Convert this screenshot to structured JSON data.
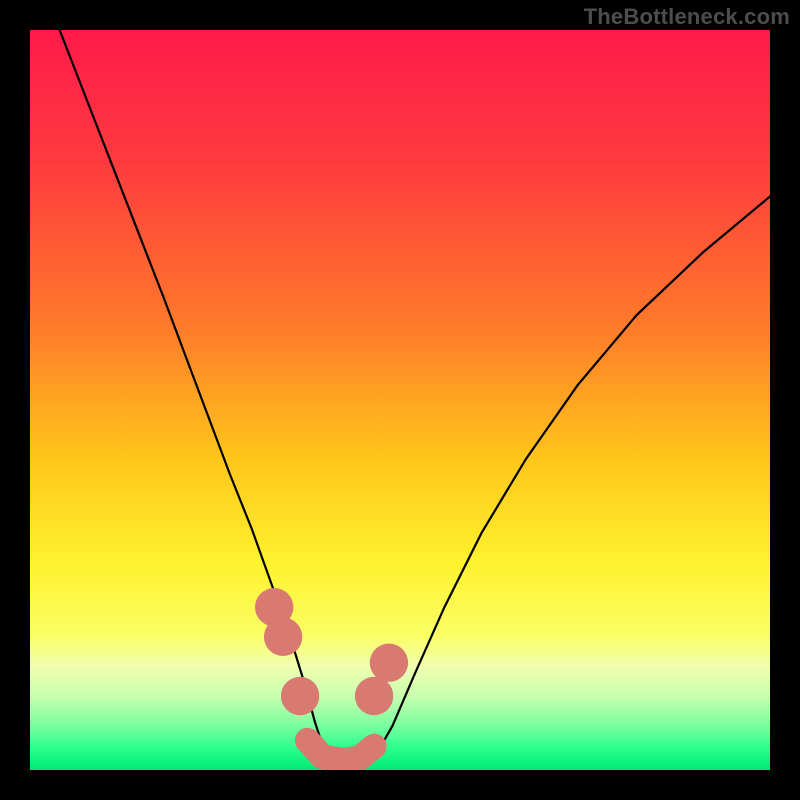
{
  "watermark": "TheBottleneck.com",
  "chart_data": {
    "type": "line",
    "title": "",
    "xlabel": "",
    "ylabel": "",
    "xlim": [
      0,
      100
    ],
    "ylim": [
      0,
      100
    ],
    "gradient_stops": [
      {
        "offset": 0.0,
        "color": "#ff1a4a"
      },
      {
        "offset": 0.18,
        "color": "#ff3b3f"
      },
      {
        "offset": 0.4,
        "color": "#ff7a2a"
      },
      {
        "offset": 0.58,
        "color": "#ffc61a"
      },
      {
        "offset": 0.72,
        "color": "#fff22e"
      },
      {
        "offset": 0.82,
        "color": "#faff66"
      },
      {
        "offset": 0.86,
        "color": "#f0ffb0"
      },
      {
        "offset": 0.9,
        "color": "#c9ffb0"
      },
      {
        "offset": 0.94,
        "color": "#7aff9e"
      },
      {
        "offset": 0.97,
        "color": "#2bff8c"
      },
      {
        "offset": 1.0,
        "color": "#00e878"
      }
    ],
    "series": [
      {
        "name": "left-branch",
        "x": [
          4.0,
          7.5,
          11.0,
          14.5,
          18.0,
          21.0,
          24.0,
          27.0,
          30.0,
          32.5,
          35.0,
          37.0,
          38.5,
          39.8
        ],
        "y": [
          100.0,
          91.0,
          82.0,
          73.0,
          64.0,
          56.0,
          48.0,
          40.0,
          32.5,
          25.5,
          18.5,
          12.0,
          6.5,
          2.5
        ]
      },
      {
        "name": "right-branch",
        "x": [
          47.0,
          49.0,
          52.0,
          56.0,
          61.0,
          67.0,
          74.0,
          82.0,
          91.0,
          100.0
        ],
        "y": [
          2.5,
          6.0,
          13.0,
          22.0,
          32.0,
          42.0,
          52.0,
          61.5,
          70.0,
          77.5
        ]
      }
    ],
    "valley_markers": {
      "name": "markers",
      "points": [
        {
          "x": 33.0,
          "y": 22.0,
          "r": 2.6
        },
        {
          "x": 34.2,
          "y": 18.0,
          "r": 2.6
        },
        {
          "x": 36.5,
          "y": 10.0,
          "r": 2.6
        },
        {
          "x": 46.5,
          "y": 10.0,
          "r": 2.6
        },
        {
          "x": 48.5,
          "y": 14.5,
          "r": 2.6
        }
      ]
    },
    "valley_band": {
      "name": "band",
      "points": [
        {
          "x": 37.5,
          "y": 4.0
        },
        {
          "x": 39.5,
          "y": 1.8
        },
        {
          "x": 42.0,
          "y": 1.3
        },
        {
          "x": 44.5,
          "y": 1.6
        },
        {
          "x": 46.5,
          "y": 3.2
        }
      ],
      "width": 3.4
    }
  }
}
